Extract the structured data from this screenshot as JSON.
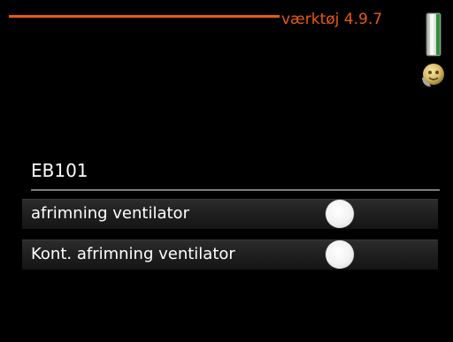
{
  "header": {
    "menu_title": "værktøj 4.9.7",
    "accent_color": "#e85a14",
    "thermometer_icon": "thermometer-icon",
    "status_icon": "smiley-icon"
  },
  "section": {
    "title": "EB101"
  },
  "options": [
    {
      "label": "afrimning ventilator",
      "toggle_state": "off"
    },
    {
      "label": "Kont. afrimning ventilator",
      "toggle_state": "off"
    }
  ]
}
